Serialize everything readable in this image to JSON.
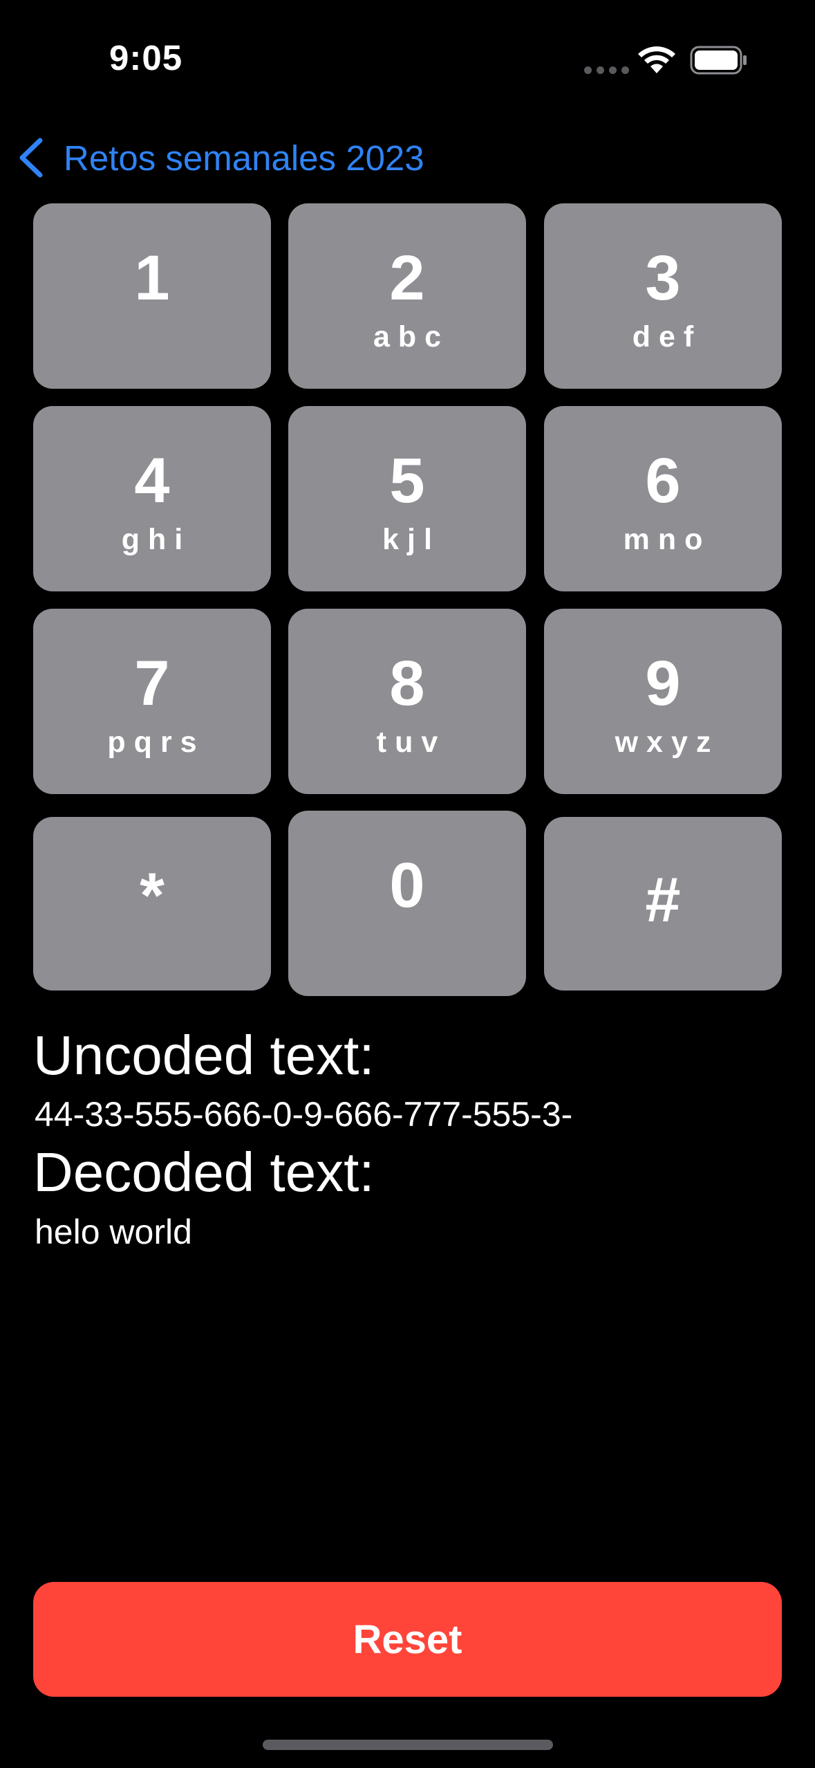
{
  "status_bar": {
    "time": "9:05",
    "icons": [
      "cellular-signal-icon",
      "wifi-icon",
      "battery-icon"
    ]
  },
  "nav": {
    "back_label": "Retos semanales 2023",
    "back_icon": "chevron-left-icon"
  },
  "keypad": {
    "keys": [
      {
        "digit": "1",
        "letters": ""
      },
      {
        "digit": "2",
        "letters": "abc"
      },
      {
        "digit": "3",
        "letters": "def"
      },
      {
        "digit": "4",
        "letters": "ghi"
      },
      {
        "digit": "5",
        "letters": "kjl"
      },
      {
        "digit": "6",
        "letters": "mno"
      },
      {
        "digit": "7",
        "letters": "pqrs"
      },
      {
        "digit": "8",
        "letters": "tuv"
      },
      {
        "digit": "9",
        "letters": "wxyz"
      },
      {
        "digit": "*",
        "letters": ""
      },
      {
        "digit": "0",
        "letters": ""
      },
      {
        "digit": "#",
        "letters": ""
      }
    ]
  },
  "output": {
    "uncoded_label": "Uncoded text:",
    "uncoded_value": "44-33-555-666-0-9-666-777-555-3-",
    "decoded_label": "Decoded text:",
    "decoded_value": "helo world"
  },
  "reset_label": "Reset",
  "colors": {
    "background": "#000000",
    "key": "#8e8e93",
    "accent": "#2f83f5",
    "reset": "#ff453a"
  }
}
